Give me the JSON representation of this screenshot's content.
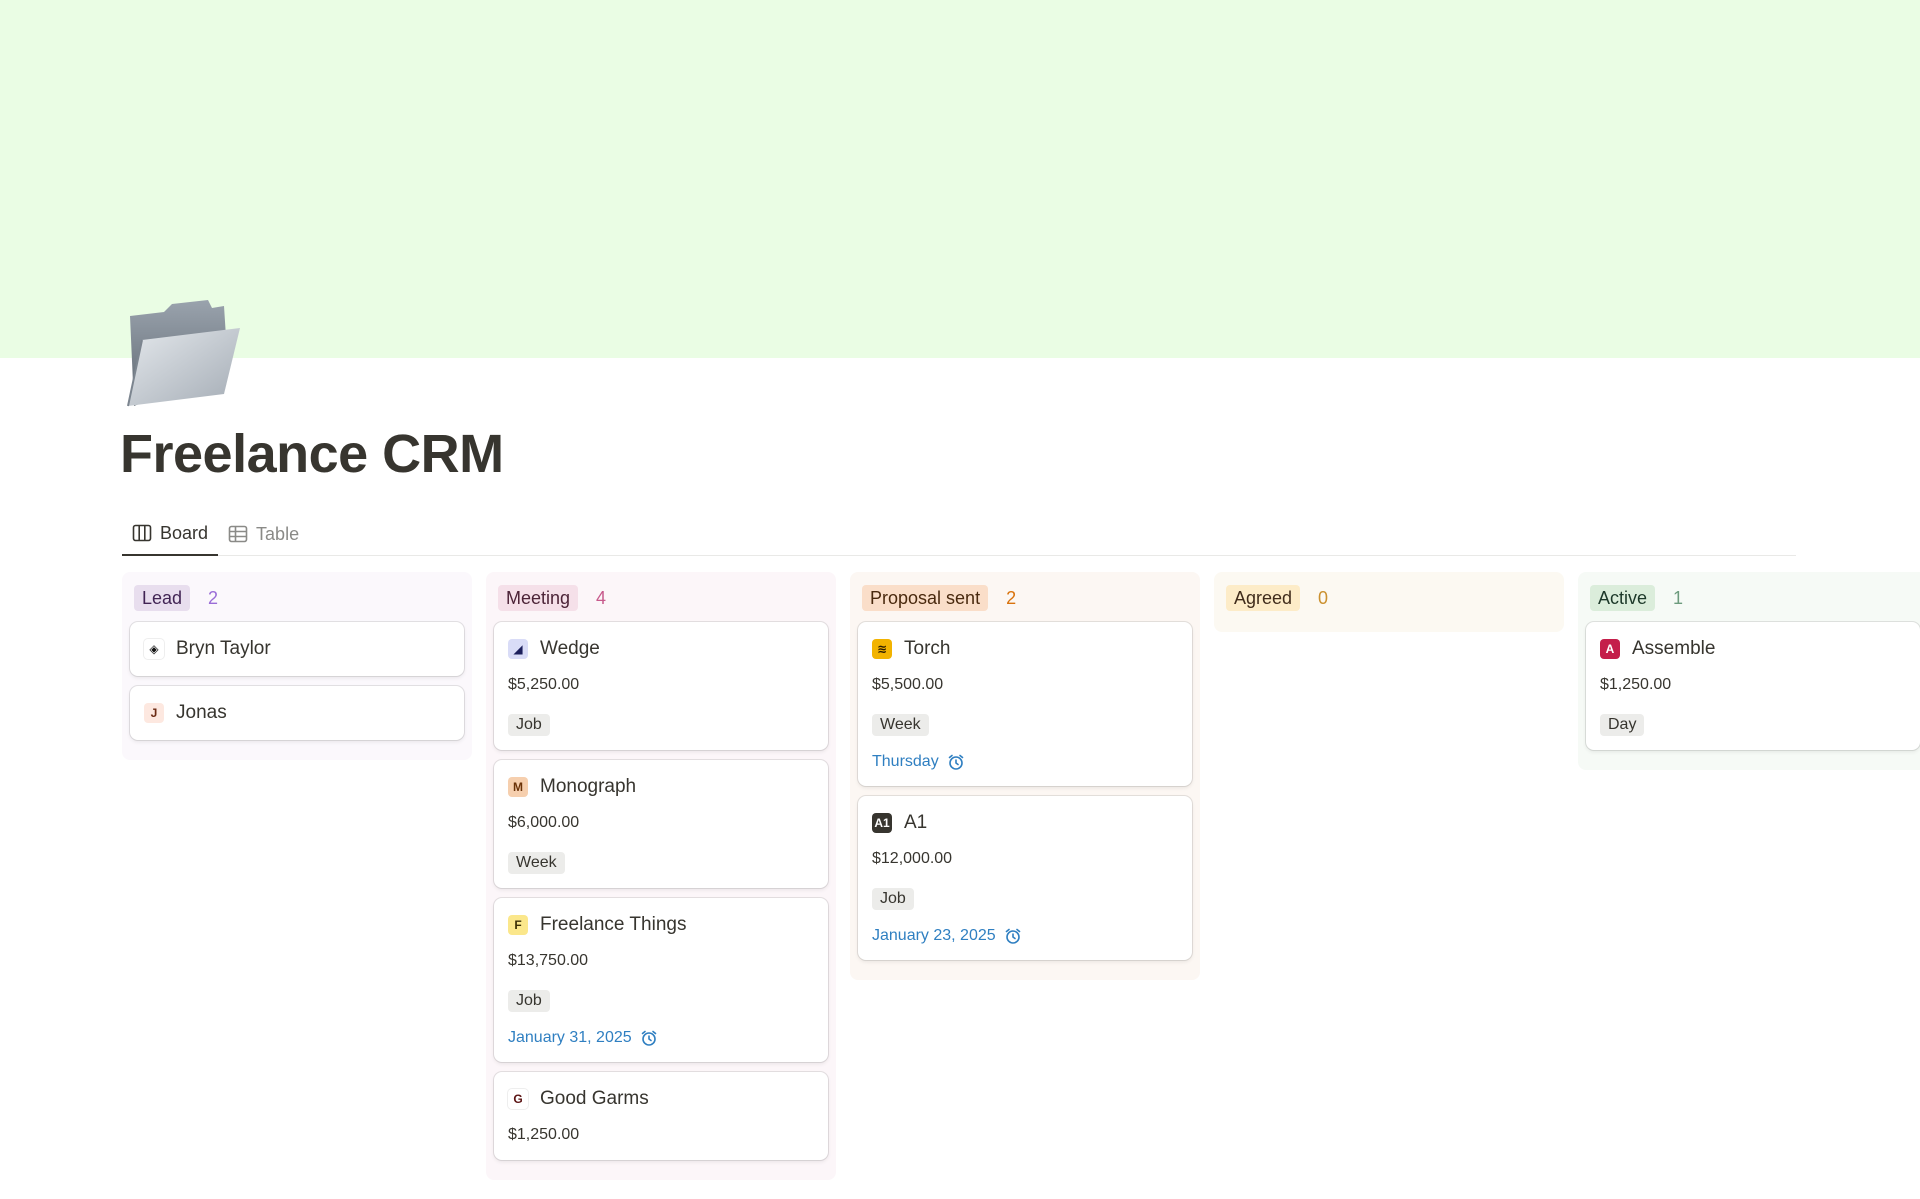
{
  "page": {
    "title": "Freelance CRM",
    "cover_color": "#eafde4",
    "icon": "folder-icon"
  },
  "tabs": [
    {
      "label": "Board",
      "icon": "board-view-icon",
      "active": true
    },
    {
      "label": "Table",
      "icon": "table-view-icon",
      "active": false
    }
  ],
  "columns": [
    {
      "name": "Lead",
      "count": "2",
      "tag_bg": "#e8deee",
      "tag_color": "#412454",
      "count_color": "#9a6dd7",
      "col_bg": "#fbf8fc",
      "cards": [
        {
          "title": "Bryn Taylor",
          "icon_text": "◈",
          "icon_bg": "#ffffff",
          "icon_color": "#111111"
        },
        {
          "title": "Jonas",
          "icon_text": "J",
          "icon_bg": "#fde8e0",
          "icon_color": "#6b2a13"
        }
      ]
    },
    {
      "name": "Meeting",
      "count": "4",
      "tag_bg": "#f5e0e9",
      "tag_color": "#4c2337",
      "count_color": "#c75a8c",
      "col_bg": "#fcf6f9",
      "cards": [
        {
          "title": "Wedge",
          "icon_text": "◢",
          "icon_bg": "#d9dcf7",
          "icon_color": "#1c1f5c",
          "amount": "$5,250.00",
          "tag": "Job"
        },
        {
          "title": "Monograph",
          "icon_text": "M",
          "icon_bg": "#f6cfae",
          "icon_color": "#6a3208",
          "amount": "$6,000.00",
          "tag": "Week"
        },
        {
          "title": "Freelance Things",
          "icon_text": "F",
          "icon_bg": "#fbe78b",
          "icon_color": "#3b2f05",
          "amount": "$13,750.00",
          "tag": "Job",
          "date": "January 31, 2025"
        },
        {
          "title": "Good Garms",
          "icon_text": "G",
          "icon_bg": "#ffffff",
          "icon_color": "#5a1212",
          "amount": "$1,250.00",
          "tag": ""
        }
      ]
    },
    {
      "name": "Proposal sent",
      "count": "2",
      "tag_bg": "#fadec9",
      "tag_color": "#49290e",
      "count_color": "#d9730d",
      "col_bg": "#fcf7f3",
      "cards": [
        {
          "title": "Torch",
          "icon_text": "≋",
          "icon_bg": "#f2b300",
          "icon_color": "#2a1b00",
          "amount": "$5,500.00",
          "tag": "Week",
          "date": "Thursday"
        },
        {
          "title": "A1",
          "icon_text": "A1",
          "icon_bg": "#37352f",
          "icon_color": "#ffffff",
          "amount": "$12,000.00",
          "tag": "Job",
          "date": "January 23, 2025"
        }
      ]
    },
    {
      "name": "Agreed",
      "count": "0",
      "tag_bg": "#fdecc8",
      "tag_color": "#402c1b",
      "count_color": "#cb912f",
      "col_bg": "#fcf9f2",
      "cards": []
    },
    {
      "name": "Active",
      "count": "1",
      "tag_bg": "#dbeddb",
      "tag_color": "#1c3829",
      "count_color": "#6c9b7d",
      "col_bg": "#f6faf6",
      "cards": [
        {
          "title": "Assemble",
          "icon_text": "A",
          "icon_bg": "#c41e4a",
          "icon_color": "#ffffff",
          "amount": "$1,250.00",
          "tag": "Day"
        }
      ]
    }
  ]
}
